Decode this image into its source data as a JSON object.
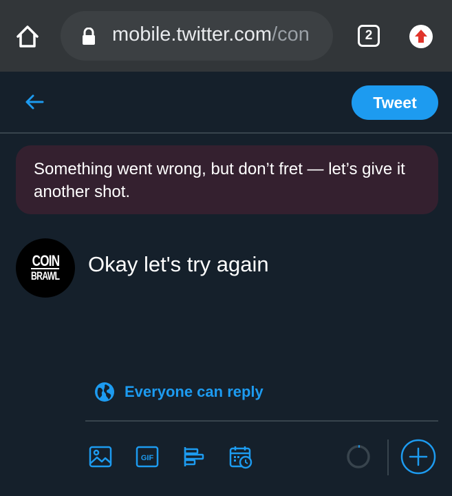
{
  "browser": {
    "url_host": "mobile.twitter.com",
    "url_path": "/con",
    "tab_count": "2",
    "icons": [
      "home-icon",
      "lock-icon",
      "tab-switcher-icon",
      "upload-extension-icon"
    ]
  },
  "header": {
    "tweet_button_label": "Tweet",
    "back_icon": "arrow-left-icon"
  },
  "error_banner": {
    "message": "Something went wrong, but don’t fret — let’s give it another shot."
  },
  "composer": {
    "avatar_text_line1": "COIN",
    "avatar_text_line2": "BRAWL",
    "tweet_text": "Okay let's try again"
  },
  "reply_setting": {
    "label": "Everyone can reply",
    "icon": "globe-icon"
  },
  "toolbar": {
    "items": [
      "image-icon",
      "gif-icon",
      "poll-icon",
      "schedule-icon"
    ],
    "progress_icon": "character-count-ring",
    "add_icon": "plus-circle-icon"
  },
  "colors": {
    "background": "#15202b",
    "accent": "#1d9bf0",
    "error_banner_bg": "#34202f",
    "divider": "#38444d",
    "browser_chrome": "#323639"
  }
}
